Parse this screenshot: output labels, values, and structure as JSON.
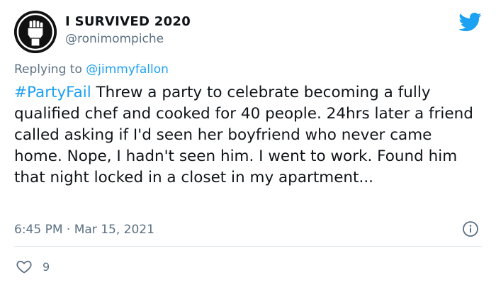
{
  "author": {
    "display_name": "I SURVIVED 2020",
    "handle": "@ronimompiche",
    "avatar_icon": "raised-fist-icon"
  },
  "reply": {
    "prefix": "Replying to ",
    "mention": "@jimmyfallon"
  },
  "tweet": {
    "hashtag": "#PartyFail",
    "body": " Threw a party to celebrate becoming a fully qualified chef and cooked for 40 people. 24hrs later a friend called asking if I'd seen her boyfriend who never came home. Nope, I hadn't seen him. I went to work. Found him that night locked in a closet in my apartment..."
  },
  "meta": {
    "time": "6:45 PM",
    "separator": " · ",
    "date": "Mar 15, 2021"
  },
  "actions": {
    "like_icon": "heart-icon",
    "like_count": "9"
  },
  "colors": {
    "accent": "#1da1f2",
    "muted": "#5b7083",
    "text": "#0f1419",
    "divider": "#e1e8ed"
  }
}
